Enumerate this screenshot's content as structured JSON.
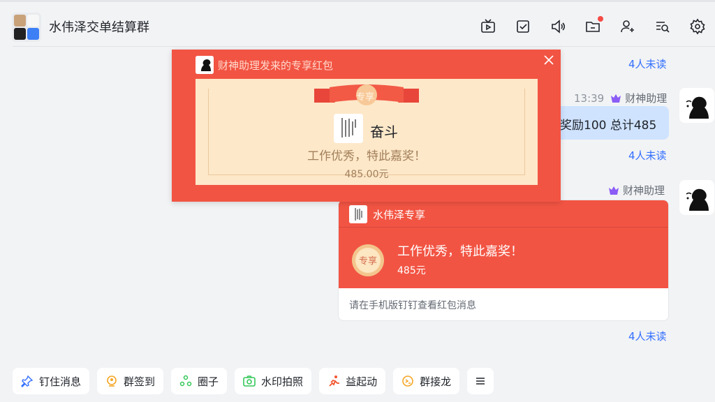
{
  "header": {
    "group_name": "水伟泽交单结算群",
    "icons": [
      "live-icon",
      "todo-icon",
      "announcement-icon",
      "files-icon",
      "add-member-icon",
      "search-history-icon",
      "settings-icon"
    ]
  },
  "messages": {
    "unread_1": "4人未读",
    "unread_2": "4人未读",
    "unread_3": "4人未读",
    "sender_1": {
      "time": "13:39",
      "name": "财神助理"
    },
    "text_bubble": "奖励100 总计485",
    "sender_2": {
      "name": "财神助理"
    }
  },
  "popup": {
    "header": "财神助理发来的专享红包",
    "ribbon": "专享",
    "sender": "奋斗",
    "message": "工作优秀，特此嘉奖！",
    "amount": "485.00元"
  },
  "envelope": {
    "title": "水伟泽专享",
    "seal": "专享",
    "message": "工作优秀，特此嘉奖！",
    "amount": "485元",
    "footer": "请在手机版钉钉查看红包消息"
  },
  "toolbar": {
    "items": [
      {
        "label": "钉住消息",
        "icon": "pin-icon"
      },
      {
        "label": "群签到",
        "icon": "checkin-icon"
      },
      {
        "label": "圈子",
        "icon": "circle-icon"
      },
      {
        "label": "水印拍照",
        "icon": "camera-icon"
      },
      {
        "label": "益起动",
        "icon": "run-icon"
      },
      {
        "label": "群接龙",
        "icon": "relay-icon"
      }
    ]
  },
  "colors": {
    "accent_blue": "#3370ff",
    "envelope_red": "#f25443",
    "bubble_blue": "#cfe3ff",
    "card_beige": "#fde8c9"
  }
}
